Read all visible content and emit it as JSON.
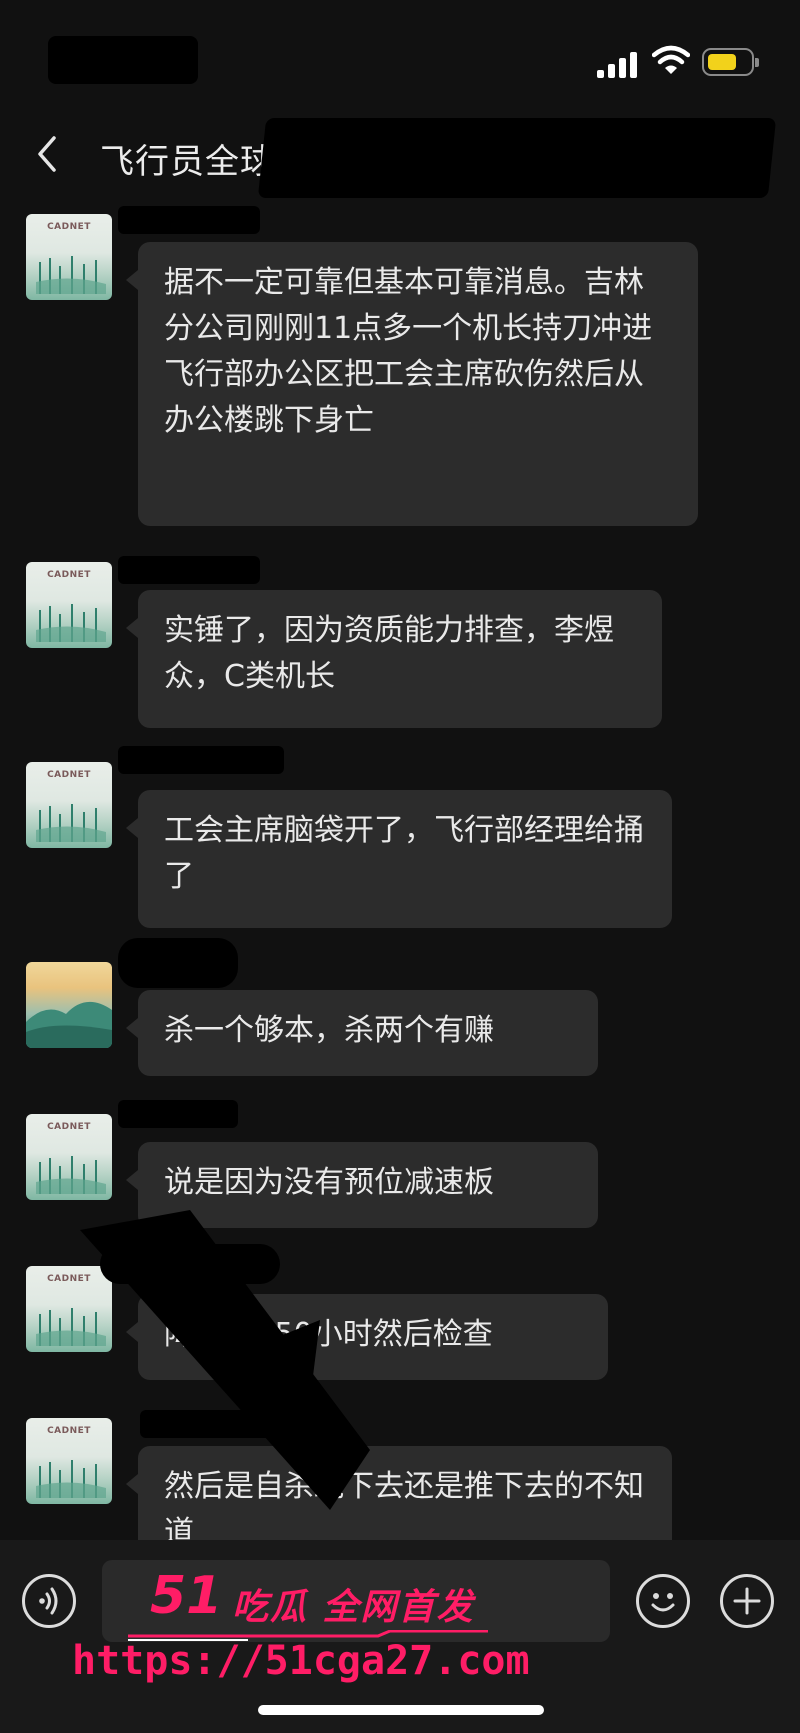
{
  "chat": {
    "title": "飞行员全球"
  },
  "messages": [
    {
      "text": "据不一定可靠但基本可靠消息。吉林分公司刚刚11点多一个机长持刀冲进飞行部办公区把工会主席砍伤然后从办公楼跳下身亡",
      "avatar": "cadnet",
      "avatar_label": "CADNET"
    },
    {
      "text": "实锤了，因为资质能力排查，李煜众，C类机长",
      "avatar": "cadnet",
      "avatar_label": "CADNET"
    },
    {
      "text": "工会主席脑袋开了，飞行部经理给捅了",
      "avatar": "cadnet",
      "avatar_label": "CADNET"
    },
    {
      "text": "杀一个够本，杀两个有赚",
      "avatar": "landscape",
      "avatar_label": ""
    },
    {
      "text": "说是因为没有预位减速板",
      "avatar": "cadnet",
      "avatar_label": "CADNET"
    },
    {
      "text": "降成Z机50小时然后检查",
      "avatar": "cadnet",
      "avatar_label": "CADNET"
    },
    {
      "text": "然后是自杀跳下去还是推下去的不知道",
      "avatar": "cadnet",
      "avatar_label": "CADNET"
    }
  ],
  "watermark": {
    "logo": "51",
    "tagline": "吃瓜 全网首发",
    "url": "https://51cga27.com"
  },
  "icons": {
    "back": "chevron-left-icon",
    "voice": "voice-icon",
    "emoji": "emoji-icon",
    "plus": "plus-icon",
    "signal": "signal-icon",
    "wifi": "wifi-icon",
    "battery": "battery-icon"
  },
  "colors": {
    "background": "#111111",
    "bubble": "#2c2c2c",
    "watermark": "#ff1d66",
    "battery": "#f2d21b"
  }
}
